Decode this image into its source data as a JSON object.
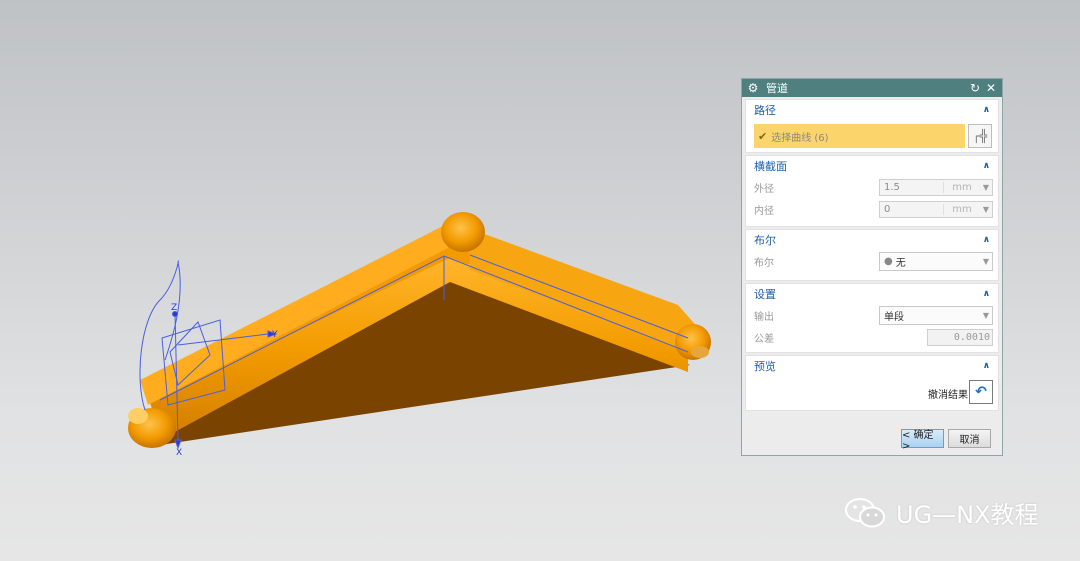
{
  "dialog": {
    "title": "管道",
    "path_section": {
      "title": "路径",
      "select_label": "选择曲线 (6)"
    },
    "cross_section": {
      "title": "横截面",
      "outer_label": "外径",
      "outer_value": "1.5",
      "outer_unit": "mm",
      "inner_label": "内径",
      "inner_value": "0",
      "inner_unit": "mm"
    },
    "boolean_section": {
      "title": "布尔",
      "label": "布尔",
      "value": "无"
    },
    "settings_section": {
      "title": "设置",
      "output_label": "输出",
      "output_value": "单段",
      "tolerance_label": "公差",
      "tolerance_value": "0.0010"
    },
    "preview_section": {
      "title": "预览",
      "undo_label": "撤消结果"
    },
    "ok_label": "< 确定 >",
    "cancel_label": "取消"
  },
  "viewport": {
    "axis_labels": {
      "x": "X",
      "y": "Y",
      "z": "Z"
    },
    "model_color": "#f0a000"
  },
  "watermark": {
    "text": "UG—NX教程"
  },
  "colors": {
    "titlebar": "#4f7f7f",
    "selection": "#fbd46b",
    "accent": "#1d5fa8"
  }
}
